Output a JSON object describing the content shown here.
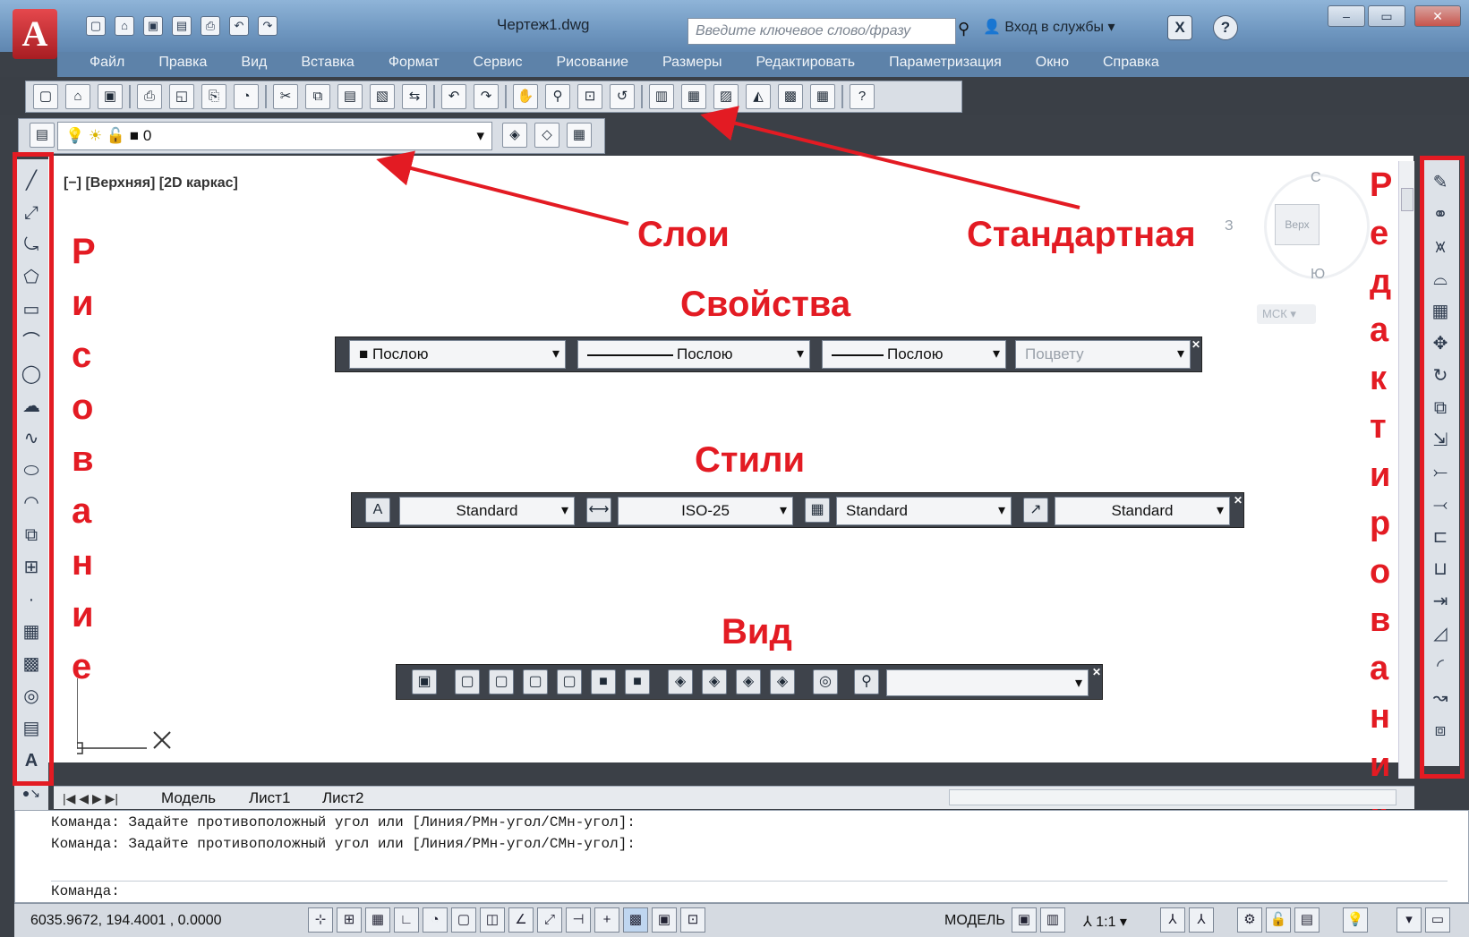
{
  "window": {
    "title": "Чертеж1.dwg",
    "search_placeholder": "Введите ключевое слово/фразу",
    "login": "Вход в службы",
    "logo": "A",
    "help": "?",
    "exchange": "X"
  },
  "menu": [
    "Файл",
    "Правка",
    "Вид",
    "Вставка",
    "Формат",
    "Сервис",
    "Рисование",
    "Размеры",
    "Редактировать",
    "Параметризация",
    "Окно",
    "Справка"
  ],
  "layer": {
    "value": "0"
  },
  "viewport_label": "[−] [Верхняя] [2D каркас]",
  "viewcube": {
    "north": "С",
    "west": "З",
    "south": "Ю",
    "top": "Верх",
    "ucs": "МСК"
  },
  "annotations": {
    "layers": "Слои",
    "standard": "Стандартная",
    "properties": "Свойства",
    "styles": "Стили",
    "view": "Вид",
    "drawing_letters": [
      "Р",
      "и",
      "с",
      "о",
      "в",
      "а",
      "н",
      "и",
      "е"
    ],
    "modify_letters": [
      "Р",
      "е",
      "д",
      "а",
      "к",
      "т",
      "и",
      "р",
      "о",
      "в",
      "а",
      "н",
      "и",
      "е"
    ]
  },
  "properties": {
    "color": "Послою",
    "linetype": "Послою",
    "lineweight": "Послою",
    "plotstyle": "Поцвету"
  },
  "styles": {
    "text": "Standard",
    "dim": "ISO-25",
    "table": "Standard",
    "mleader": "Standard"
  },
  "tabs": [
    "Модель",
    "Лист1",
    "Лист2"
  ],
  "command": {
    "line1": "Команда: Задайте противоположный угол или [Линия/РМн-угол/СМн-угол]:",
    "line2": "Команда: Задайте противоположный угол или [Линия/РМн-угол/СМн-угол]:",
    "prompt": "Команда:"
  },
  "status": {
    "coords": "6035.9672, 194.4001 , 0.0000",
    "model": "МОДЕЛЬ",
    "scale": "1:1"
  },
  "colors": {
    "accent_red": "#e31b23",
    "canvas": "#ffffff",
    "chrome_dark": "#3b4047",
    "titlebar": "#6f97c0"
  }
}
